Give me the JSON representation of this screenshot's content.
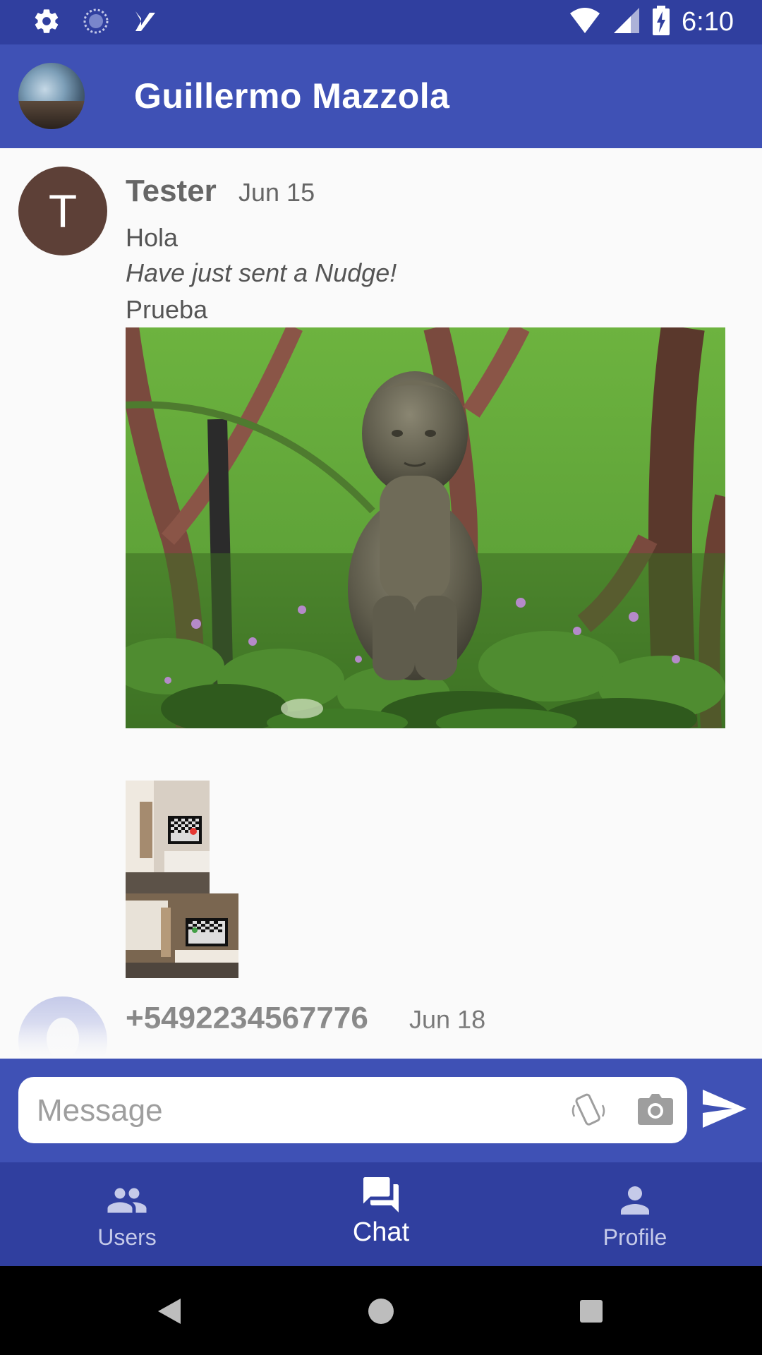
{
  "status_bar": {
    "time": "6:10",
    "icons": [
      "gear-icon",
      "sync-icon",
      "check-task-icon",
      "wifi-icon",
      "signal-icon",
      "battery-charging-icon"
    ]
  },
  "header": {
    "title": "Guillermo Mazzola",
    "avatar_icon": "profile-photo"
  },
  "messages": [
    {
      "avatar_letter": "T",
      "sender": "Tester",
      "date": "Jun 15",
      "lines": [
        "Hola",
        "Have just sent a Nudge!",
        "Prueba"
      ],
      "images": [
        "garden-statue-photo",
        "room-tv-photo-portrait",
        "room-tv-photo-landscape"
      ]
    },
    {
      "sender": "+5492234567776",
      "date": "Jun 18"
    }
  ],
  "composer": {
    "placeholder": "Message",
    "value": ""
  },
  "bottom_nav": {
    "items": [
      {
        "label": "Users",
        "icon": "users-icon"
      },
      {
        "label": "Chat",
        "icon": "chat-icon",
        "active": true
      },
      {
        "label": "Profile",
        "icon": "profile-icon"
      }
    ]
  },
  "colors": {
    "primary": "#3f51b5",
    "primary_dark": "#303f9f",
    "avatar_brown": "#5d4037"
  }
}
